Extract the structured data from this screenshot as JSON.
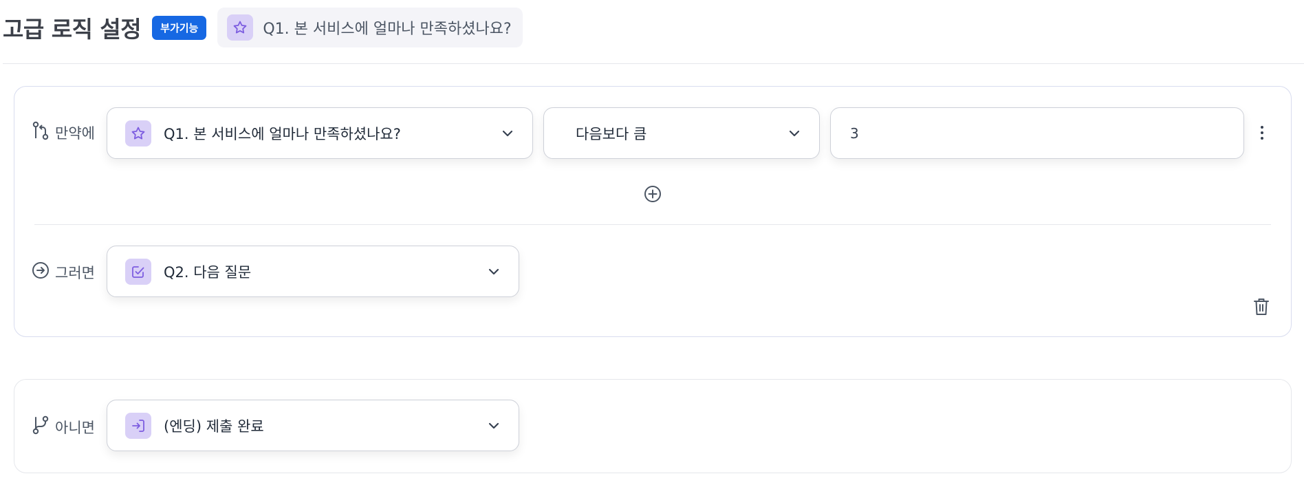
{
  "header": {
    "title": "고급 로직 설정",
    "badge": "부가기능",
    "question_chip": "Q1. 본 서비스에 얼마나 만족하셨나요?"
  },
  "rule": {
    "if_label": "만약에",
    "condition_question": "Q1. 본 서비스에 얼마나 만족하셨나요?",
    "operator": "다음보다 큼",
    "value": "3",
    "then_label": "그러면",
    "then_target": "Q2. 다음 질문"
  },
  "else_rule": {
    "label": "아니면",
    "target": "(엔딩) 제출 완료"
  },
  "colors": {
    "accent_badge": "#1668e3",
    "icon_bg": "#d9d0f7",
    "icon_fg": "#7c5ce0"
  }
}
